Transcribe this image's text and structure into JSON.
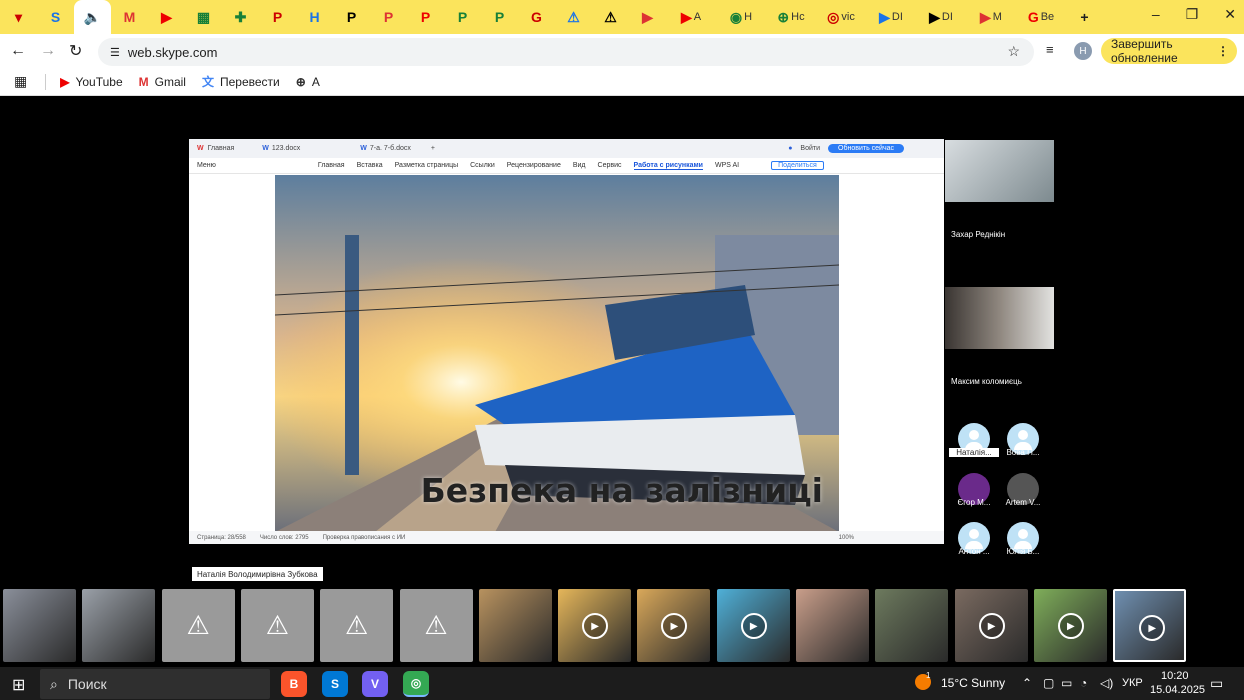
{
  "browser": {
    "url": "web.skype.com",
    "update_button": "Завершить обновление",
    "profile_initial": "H",
    "tabs": [
      {
        "icon": "▾",
        "label": ""
      },
      {
        "icon": "S",
        "label": ""
      },
      {
        "icon": "🔈",
        "label": "",
        "active": true
      },
      {
        "icon": "M",
        "label": ""
      },
      {
        "icon": "▶",
        "label": ""
      },
      {
        "icon": "▦",
        "label": ""
      },
      {
        "icon": "✚",
        "label": ""
      },
      {
        "icon": "P",
        "label": ""
      },
      {
        "icon": "H",
        "label": ""
      },
      {
        "icon": "P",
        "label": ""
      },
      {
        "icon": "P",
        "label": ""
      },
      {
        "icon": "P",
        "label": ""
      },
      {
        "icon": "P",
        "label": ""
      },
      {
        "icon": "P",
        "label": ""
      },
      {
        "icon": "G",
        "label": ""
      },
      {
        "icon": "⚠",
        "label": ""
      },
      {
        "icon": "⚠",
        "label": ""
      },
      {
        "icon": "▶",
        "label": ""
      },
      {
        "icon": "▶",
        "label": "A"
      },
      {
        "icon": "◉",
        "label": "H"
      },
      {
        "icon": "⊕",
        "label": "Hc"
      },
      {
        "icon": "◎",
        "label": "vic"
      },
      {
        "icon": "▶",
        "label": "DI"
      },
      {
        "icon": "▶",
        "label": "DI"
      },
      {
        "icon": "▶",
        "label": "M"
      },
      {
        "icon": "G",
        "label": "Be"
      }
    ],
    "bookmarks": [
      {
        "icon": "▶",
        "label": "YouTube"
      },
      {
        "icon": "M",
        "label": "Gmail"
      },
      {
        "icon": "文",
        "label": "Перевести"
      },
      {
        "icon": "⊕",
        "label": "A"
      }
    ]
  },
  "shared_doc": {
    "tabs": [
      "Главная",
      "123.docx",
      "7-а. 7-б.docx"
    ],
    "login": "Войти",
    "refresh_btn": "Обновить сейчас",
    "menu": [
      "Меню",
      "Главная",
      "Вставка",
      "Разметка страницы",
      "Ссылки",
      "Рецензирование",
      "Вид",
      "Сервис",
      "Работа с рисунками",
      "WPS AI"
    ],
    "share_btn": "Поделиться",
    "image_caption": "Безпека на залізниці",
    "status": [
      "Страница: 28/558",
      "Число слов: 2795",
      "Проверка правописания с ИИ"
    ],
    "zoom": "100%"
  },
  "participants": {
    "video": [
      {
        "name": "Захар Реднікін"
      },
      {
        "name": "Максим коломиєць"
      }
    ],
    "avatars": [
      {
        "name": "Наталія..."
      },
      {
        "name": "Вова П..."
      },
      {
        "name": "Єгор М..."
      },
      {
        "name": "Artem V..."
      },
      {
        "name": "Антон ..."
      },
      {
        "name": "Юлія Б..."
      }
    ]
  },
  "tooltip": "Наталія Володимирівна Зубкова",
  "taskbar": {
    "search_placeholder": "Поиск",
    "weather": "15°C  Sunny",
    "weather_badge": "1",
    "lang": "УКР",
    "time": "10:20",
    "date": "15.04.2025"
  },
  "colors": {
    "tab_bar": "#fbe45c",
    "update_button": "#fbe45c",
    "avatar": "#bfe2f6",
    "doc_accent": "#1a56db"
  }
}
